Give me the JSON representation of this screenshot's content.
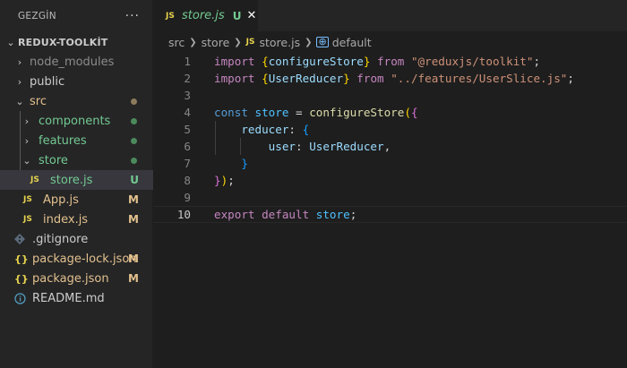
{
  "explorer": {
    "title": "GEZGİN",
    "more": "···",
    "root": "REDUX-TOOLKİT",
    "items": [
      {
        "label": "node_modules",
        "color": "#8c8c8c"
      },
      {
        "label": "public",
        "color": "#cccccc"
      },
      {
        "label": "src",
        "color": "#73c991"
      },
      {
        "label": "components",
        "color": "#73c991"
      },
      {
        "label": "features",
        "color": "#73c991"
      },
      {
        "label": "store",
        "color": "#73c991"
      },
      {
        "label": "store.js",
        "color": "#73c991",
        "badge": "U"
      },
      {
        "label": "App.js",
        "color": "#e2c08d",
        "badge": "M"
      },
      {
        "label": "index.js",
        "color": "#e2c08d",
        "badge": "M"
      },
      {
        "label": ".gitignore",
        "color": "#cccccc"
      },
      {
        "label": "package-lock.json",
        "color": "#e2c08d",
        "badge": "M"
      },
      {
        "label": "package.json",
        "color": "#e2c08d",
        "badge": "M"
      },
      {
        "label": "README.md",
        "color": "#cccccc"
      }
    ],
    "dot_colors": {
      "src": "#8c7c5c",
      "green": "#4c8a5c"
    }
  },
  "tab": {
    "icon": "JS",
    "name": "store.js",
    "status": "U",
    "close": "✕"
  },
  "breadcrumb": {
    "parts": [
      "src",
      "store",
      "store.js",
      "default"
    ],
    "js_icon": "JS",
    "symbol_icon": "⊕"
  },
  "code": {
    "line_numbers": [
      "1",
      "2",
      "3",
      "4",
      "5",
      "6",
      "7",
      "8",
      "9",
      "10"
    ],
    "l1": {
      "kw": "import",
      "b": "{",
      "id": "configureStore",
      "be": "}",
      "from": "from",
      "str": "\"@reduxjs/toolkit\"",
      "end": ";"
    },
    "l2": {
      "kw": "import",
      "b": "{",
      "id": "UserReducer",
      "be": "}",
      "from": "from",
      "str": "\"../features/UserSlice.js\"",
      "end": ";"
    },
    "l4": {
      "kw": "const",
      "var": "store",
      "eq": " = ",
      "fn": "configureStore",
      "p": "(",
      "b": "{"
    },
    "l5": {
      "prop": "reducer",
      "colon": ": ",
      "b": "{"
    },
    "l6": {
      "prop": "user",
      "colon": ": ",
      "val": "UserReducer",
      "comma": ","
    },
    "l7": {
      "b": "}"
    },
    "l8": {
      "b": "}",
      "p": ")",
      "end": ";"
    },
    "l10": {
      "kw": "export",
      "kw2": "default",
      "var": "store",
      "end": ";"
    }
  }
}
